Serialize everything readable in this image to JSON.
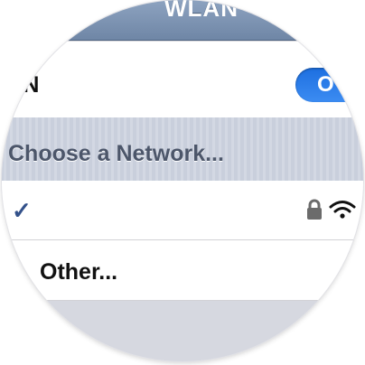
{
  "navbar": {
    "title": "WLAN"
  },
  "wlan": {
    "label": "LAN",
    "toggle_text": "O"
  },
  "section": {
    "title": "Choose a Network..."
  },
  "networks": [
    {
      "selected": true,
      "check_glyph": "✓",
      "secured": true,
      "icons": [
        "lock-icon",
        "wifi-icon"
      ]
    }
  ],
  "other": {
    "label": "Other..."
  },
  "colors": {
    "navbar": "#7a90ae",
    "toggle": "#2a7ce8",
    "checkmark": "#33518a",
    "section_text": "#4c566a"
  }
}
